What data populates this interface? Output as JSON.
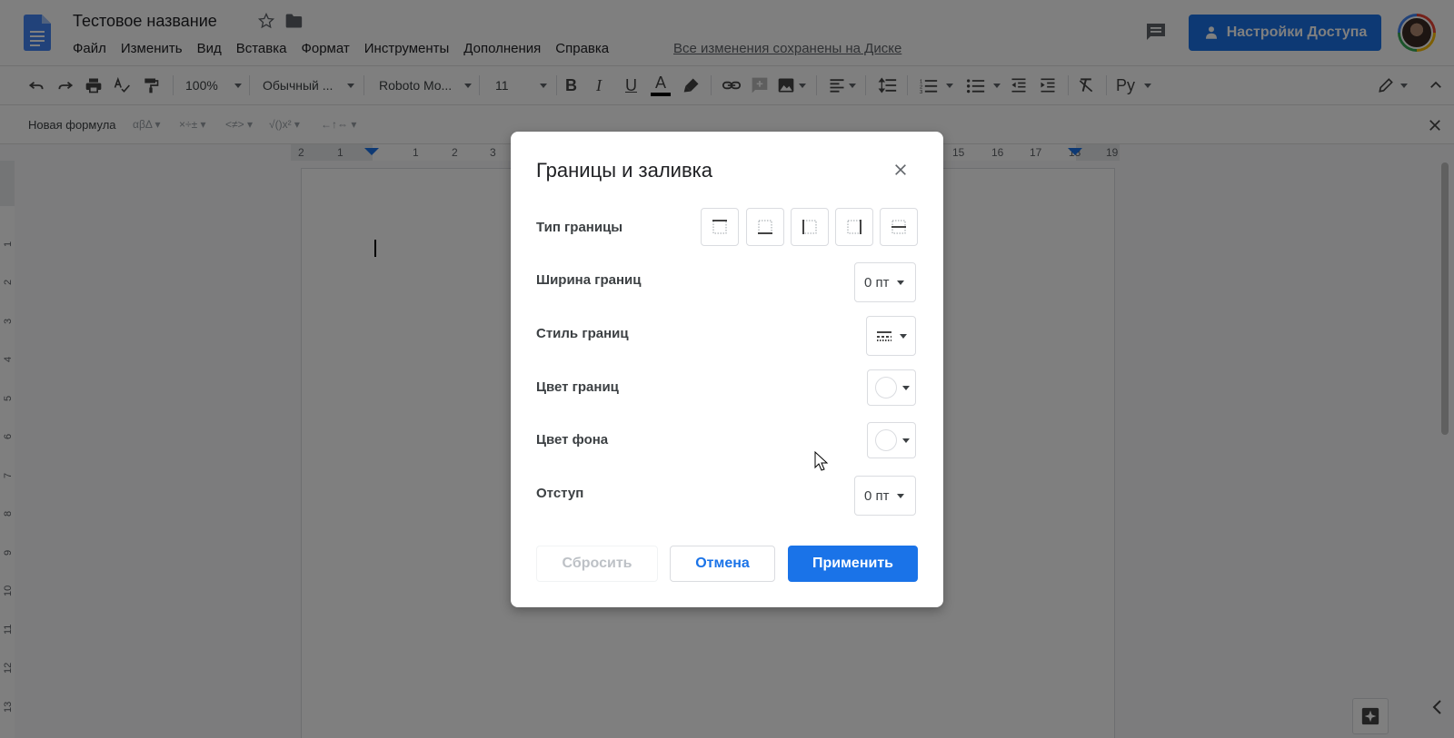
{
  "header": {
    "doc_title": "Тестовое название",
    "menu": [
      "Файл",
      "Изменить",
      "Вид",
      "Вставка",
      "Формат",
      "Инструменты",
      "Дополнения",
      "Справка"
    ],
    "saved_status": "Все изменения сохранены на Диске",
    "share_label": "Настройки Доступа"
  },
  "toolbar": {
    "zoom": "100%",
    "style": "Обычный ...",
    "font": "Roboto Mo...",
    "font_size": "11",
    "input_tools": "Ру"
  },
  "equation_bar": {
    "new_formula": "Новая формула",
    "groups": [
      "αβΔ",
      "×÷±",
      "<≠>",
      "√()x²",
      "←↑⇔"
    ]
  },
  "ruler": {
    "h_ticks": [
      "2",
      "1",
      "1",
      "2",
      "3",
      "15",
      "16",
      "17",
      "18",
      "19"
    ],
    "v_ticks": [
      "1",
      "2",
      "3",
      "4",
      "5",
      "6",
      "7",
      "8",
      "9",
      "10",
      "11",
      "12",
      "13"
    ]
  },
  "dialog": {
    "title": "Границы и заливка",
    "border_type_label": "Тип границы",
    "border_types": [
      "top-border-icon",
      "bottom-border-icon",
      "left-border-icon",
      "right-border-icon",
      "between-border-icon"
    ],
    "border_width_label": "Ширина границ",
    "border_width_value": "0 пт",
    "border_style_label": "Стиль границ",
    "border_color_label": "Цвет границ",
    "background_color_label": "Цвет фона",
    "padding_label": "Отступ",
    "padding_value": "0 пт",
    "reset_label": "Сбросить",
    "cancel_label": "Отмена",
    "apply_label": "Применить"
  },
  "colors": {
    "accent": "#1a73e8",
    "docs_blue": "#4285f4",
    "overlay": "rgba(0,0,0,0.5)"
  }
}
